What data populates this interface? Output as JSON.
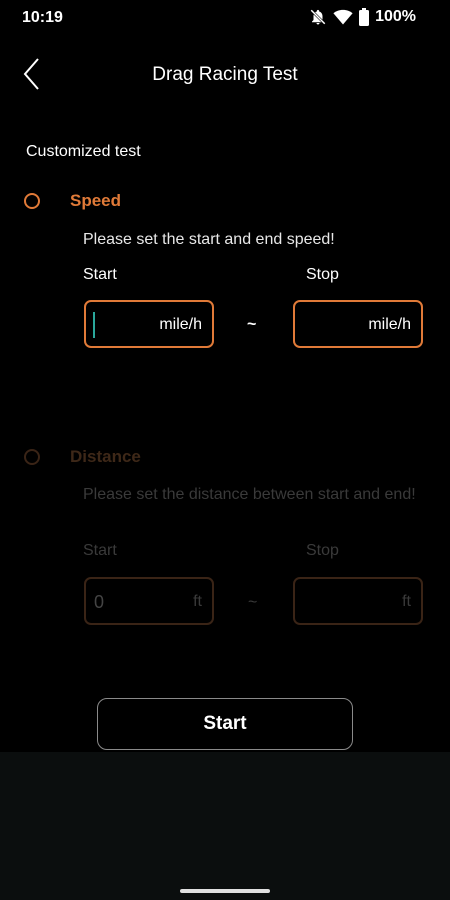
{
  "status_bar": {
    "time": "10:19",
    "battery": "100%",
    "icons": [
      "notifications-off-icon",
      "wifi-icon",
      "battery-icon"
    ]
  },
  "header": {
    "title": "Drag Racing Test",
    "back_icon": "back-chevron-icon"
  },
  "section_label": "Customized test",
  "speed": {
    "label": "Speed",
    "selected": false,
    "hint": "Please set the start and end speed!",
    "start_label": "Start",
    "stop_label": "Stop",
    "start_value": "",
    "stop_value": "",
    "unit": "mile/h",
    "separator": "~"
  },
  "distance": {
    "label": "Distance",
    "selected": false,
    "hint": "Please set the distance between start and end!",
    "start_label": "Start",
    "stop_label": "Stop",
    "start_value": "0",
    "stop_value": "",
    "unit": "ft",
    "separator": "~"
  },
  "start_button": {
    "label": "Start"
  },
  "colors": {
    "accent": "#e07a38",
    "background": "#000000",
    "caret": "#2aa79b"
  }
}
